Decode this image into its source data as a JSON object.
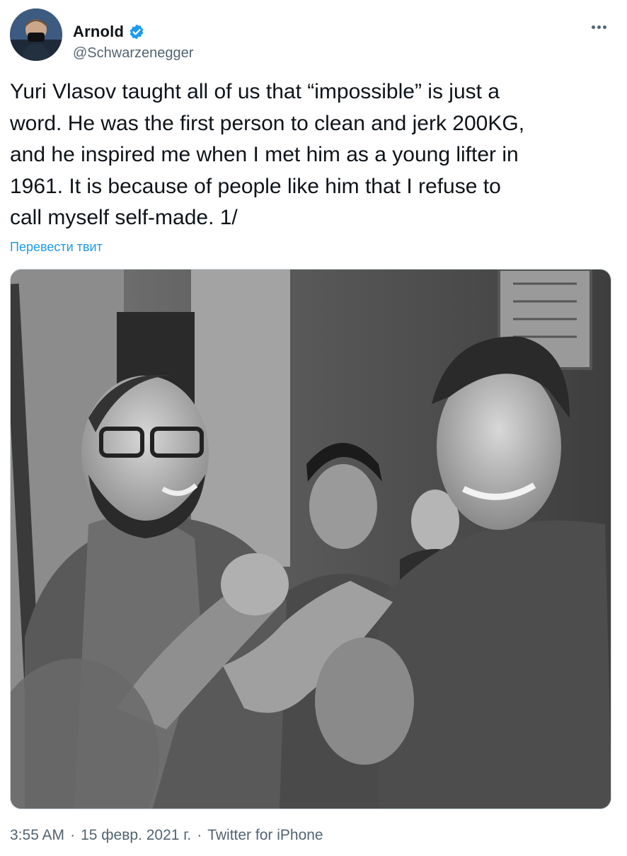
{
  "author": {
    "display_name": "Arnold",
    "handle": "@Schwarzenegger",
    "verified": true
  },
  "tweet": {
    "text": "Yuri Vlasov taught all of us that “impossible” is just a\nword. He was the first person to clean and jerk 200KG,\nand he inspired me when I met him as a young lifter in\n1961. It is because of people like him that I refuse to\ncall myself self-made. 1/",
    "translate_label": "Перевести твит"
  },
  "meta": {
    "time": "3:55 AM",
    "separator": "·",
    "date": "15 февр. 2021 г.",
    "source": "Twitter for iPhone"
  },
  "colors": {
    "accent": "#1d9bf0",
    "secondary_text": "#536471",
    "primary_text": "#0f1419"
  },
  "icons": {
    "verified": "verified-badge-icon",
    "more": "more-horizontal-icon"
  }
}
